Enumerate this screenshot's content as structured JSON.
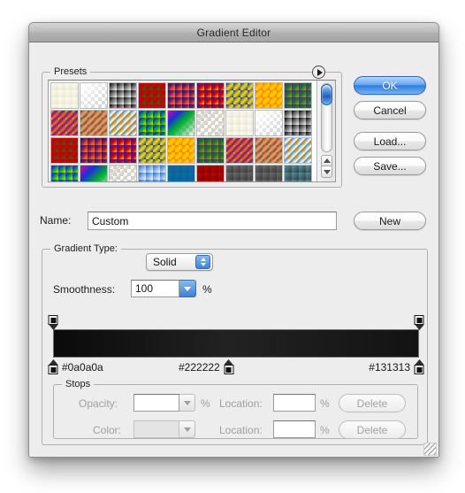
{
  "window": {
    "title": "Gradient Editor"
  },
  "presets": {
    "legend": "Presets",
    "flyout_icon": "flyout-arrow-icon",
    "scrollbar": {
      "thumb_icon": "scroll-thumb",
      "up_icon": "scroll-up-arrow-icon",
      "down_icon": "scroll-down-arrow-icon"
    },
    "swatches": [
      {
        "name": "foreground-to-background",
        "css": "linear-gradient(to bottom right,#fdfdf2,#e8e5cf)"
      },
      {
        "name": "foreground-to-transparent",
        "css": "linear-gradient(to bottom right,#ffffff,rgba(230,228,208,0))",
        "checker": true
      },
      {
        "name": "black-white",
        "css": "linear-gradient(to bottom right,#000000,#ffffff)"
      },
      {
        "name": "red-green",
        "css": "linear-gradient(to bottom right,#d40000,#c00000 40%,#0f7a1c)"
      },
      {
        "name": "violet-orange",
        "css": "linear-gradient(to bottom right,#2a0a52,#7a2060 45%,#e85a10,#f07b00)"
      },
      {
        "name": "blue-red-yellow",
        "css": "linear-gradient(to bottom right,#0a1ec0,#d50000 55%,#f2d000)"
      },
      {
        "name": "blue-yellow-blue",
        "css": "linear-gradient(to bottom right,#0a1ec0,#f2e000 50%,#0a1ec0)"
      },
      {
        "name": "orange-yellow-orange",
        "css": "linear-gradient(to bottom right,#ff6a00,#ffd400 50%,#ff6a00)"
      },
      {
        "name": "violet-green-orange",
        "css": "linear-gradient(to bottom right,#6b1480,#0c7a30 50%,#ff7a00)"
      },
      {
        "name": "yellow-violet-orange-blue",
        "css": "linear-gradient(to bottom right,#ffd400,#7a1090 35%,#ff6a00 65%,#0a1ec0)"
      },
      {
        "name": "copper",
        "css": "linear-gradient(to bottom right,#7a3a14,#e8a678 45%,#8a4a20,#f0cdb0)"
      },
      {
        "name": "chrome",
        "css": "linear-gradient(to bottom right,#1a7fd4,#ffffff 42%,#b07a10 58%,#ffffff)"
      },
      {
        "name": "spectrum",
        "css": "linear-gradient(to bottom right,#e000b0,#1a30d8 25%,#00b030 55%,#e8e000)"
      },
      {
        "name": "transparent-rainbow",
        "css": "linear-gradient(to bottom right,#e000b0,#1a30d8 25%,#00b030 50%,rgba(232,224,0,0))",
        "checker": true
      },
      {
        "name": "transparent-stripes",
        "css": "repeating-linear-gradient(135deg,rgba(220,215,195,0.85) 0 3px,rgba(255,255,255,0) 3px 7px)",
        "checker": true
      },
      {
        "name": "foreground-to-background-2",
        "css": "linear-gradient(to bottom right,#fdfdf2,#e8e5cf)"
      },
      {
        "name": "foreground-to-transparent-2",
        "css": "linear-gradient(to bottom right,#ffffff,rgba(230,228,208,0))",
        "checker": true
      },
      {
        "name": "black-white-2",
        "css": "linear-gradient(to bottom right,#000000,#ffffff)"
      },
      {
        "name": "red-green-2",
        "css": "linear-gradient(to bottom right,#d40000,#c00000 40%,#0f7a1c)"
      },
      {
        "name": "violet-orange-2",
        "css": "linear-gradient(to bottom right,#2a0a52,#7a2060 45%,#e85a10,#f07b00)"
      },
      {
        "name": "blue-red-yellow-2",
        "css": "linear-gradient(to bottom right,#0a1ec0,#d50000 55%,#f2d000)"
      },
      {
        "name": "blue-yellow-blue-2",
        "css": "linear-gradient(to bottom right,#0a1ec0,#f2e000 50%,#0a1ec0)"
      },
      {
        "name": "orange-yellow-orange-2",
        "css": "linear-gradient(to bottom right,#ff6a00,#ffd400 50%,#ff6a00)"
      },
      {
        "name": "violet-green-orange-2",
        "css": "linear-gradient(to bottom right,#6b1480,#0c7a30 50%,#ff7a00)"
      },
      {
        "name": "yellow-violet-orange-blue-2",
        "css": "linear-gradient(to bottom right,#ffd400,#7a1090 35%,#ff6a00 65%,#0a1ec0)"
      },
      {
        "name": "copper-2",
        "css": "linear-gradient(to bottom right,#7a3a14,#e8a678 45%,#8a4a20,#f0cdb0)"
      },
      {
        "name": "chrome-2",
        "css": "linear-gradient(to bottom right,#1a7fd4,#ffffff 42%,#b07a10 58%,#ffffff)"
      },
      {
        "name": "spectrum-2",
        "css": "linear-gradient(to bottom right,#e000b0,#1a30d8 25%,#00b030 55%,#e8e000)"
      },
      {
        "name": "transparent-rainbow-2",
        "css": "linear-gradient(to bottom right,#e000b0,#1a30d8 30%,#00b030 60%,rgba(232,224,0,0))",
        "checker": true
      },
      {
        "name": "transparent-stripes-2",
        "css": "repeating-linear-gradient(135deg,rgba(220,215,195,0.85) 0 3px,rgba(255,255,255,0) 3px 7px)",
        "checker": true
      },
      {
        "name": "blue-white",
        "css": "linear-gradient(to bottom right,#1a6fd0,#ffffff)"
      },
      {
        "name": "steel-blue",
        "css": "linear-gradient(to bottom right,#0d6fa8,#0a5e90)"
      },
      {
        "name": "red-dark",
        "css": "linear-gradient(to bottom right,#d40000,#6a0000)"
      },
      {
        "name": "grey-fade",
        "css": "linear-gradient(to bottom right,#6e6e6e,#3a3a3a)"
      },
      {
        "name": "grey-fade-2",
        "css": "linear-gradient(to bottom right,#6e6e6e,#3a3a3a)"
      },
      {
        "name": "teal-grey",
        "css": "linear-gradient(to bottom right,#4a9aa8,#3a3a3a)"
      }
    ]
  },
  "buttons": {
    "ok": "OK",
    "cancel": "Cancel",
    "load": "Load...",
    "save": "Save...",
    "new": "New"
  },
  "name_row": {
    "label": "Name:",
    "value": "Custom",
    "placeholder": ""
  },
  "gradient_type": {
    "legend": "Gradient Type:",
    "selected": "Solid",
    "stepper_icon": "stepper-up-down-icon"
  },
  "smoothness": {
    "label": "Smoothness:",
    "value": "100",
    "unit": "%",
    "dropdown_icon": "chevron-down-icon"
  },
  "gradient_bar": {
    "css": "linear-gradient(to right,#0a0a0a 0%,#222222 48%,#131313 100%)",
    "opacity_stops": [
      {
        "name": "opacity-stop-left",
        "position_pct": 0
      },
      {
        "name": "opacity-stop-right",
        "position_pct": 100
      }
    ],
    "color_stops": [
      {
        "name": "color-stop-1",
        "hex": "#0a0a0a",
        "position_pct": 0,
        "label_side": "right"
      },
      {
        "name": "color-stop-2",
        "hex": "#222222",
        "position_pct": 48,
        "label_side": "left"
      },
      {
        "name": "color-stop-3",
        "hex": "#131313",
        "position_pct": 100,
        "label_side": "left"
      }
    ]
  },
  "stops": {
    "legend": "Stops",
    "opacity_label": "Opacity:",
    "opacity_value": "",
    "opacity_unit": "%",
    "opacity_location_label": "Location:",
    "opacity_location_value": "",
    "opacity_location_unit": "%",
    "opacity_delete": "Delete",
    "color_label": "Color:",
    "color_value": "",
    "color_location_label": "Location:",
    "color_location_value": "",
    "color_location_unit": "%",
    "color_delete": "Delete"
  },
  "resize_grip": "resize-grip"
}
